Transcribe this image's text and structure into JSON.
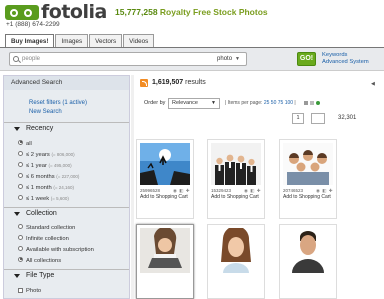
{
  "header": {
    "logo_text": "fotolia",
    "phone": "+1 (888) 674-2299",
    "tagline_count": "15,777,258",
    "tagline_text": "Royalty Free Stock Photos"
  },
  "tabs": [
    "Buy Images!",
    "Images",
    "Vectors",
    "Videos"
  ],
  "search": {
    "value": "people",
    "type": "photo",
    "go_label": "GO!",
    "keywords_label": "Keywords",
    "advanced_label": "Advanced System"
  },
  "sidebar": {
    "title": "Advanced Search",
    "reset_label": "Reset filters (1 active)",
    "new_search_label": "New Search",
    "recency": {
      "title": "Recency",
      "options": [
        {
          "label": "all",
          "count": ""
        },
        {
          "label": "≤ 2 years",
          "count": "(= 806,000)"
        },
        {
          "label": "≤ 1 year",
          "count": "(= 495,000)"
        },
        {
          "label": "≤ 6 months",
          "count": "(= 227,000)"
        },
        {
          "label": "≤ 1 month",
          "count": "(= 24,160)"
        },
        {
          "label": "≤ 1 week",
          "count": "(= 5,600)"
        }
      ]
    },
    "collection": {
      "title": "Collection",
      "options": [
        "Standard collection",
        "Infinite collection",
        "Available with subscription",
        "All collections"
      ]
    },
    "file_type": {
      "title": "File Type",
      "first_option": "Photo"
    }
  },
  "results": {
    "count": "1,619,507",
    "label": "results",
    "order_label": "Order by",
    "order_value": "Relevance",
    "ipp_label": "Items per page:",
    "ipp_options": [
      "25",
      "50",
      "75",
      "100"
    ],
    "page_current": "1",
    "page_total": "32,301"
  },
  "thumbnails": [
    {
      "id": "25996528",
      "add": "Add to Shopping Cart"
    },
    {
      "id": "15329423",
      "add": "Add to Shopping Cart"
    },
    {
      "id": "20746523",
      "add": "Add to Shopping Cart"
    },
    {
      "id": "",
      "add": ""
    },
    {
      "id": "",
      "add": ""
    },
    {
      "id": "",
      "add": ""
    }
  ],
  "colors": {
    "accent_green": "#6aaa1e",
    "link_blue": "#1a5fa8",
    "rss_orange": "#f28c24"
  }
}
